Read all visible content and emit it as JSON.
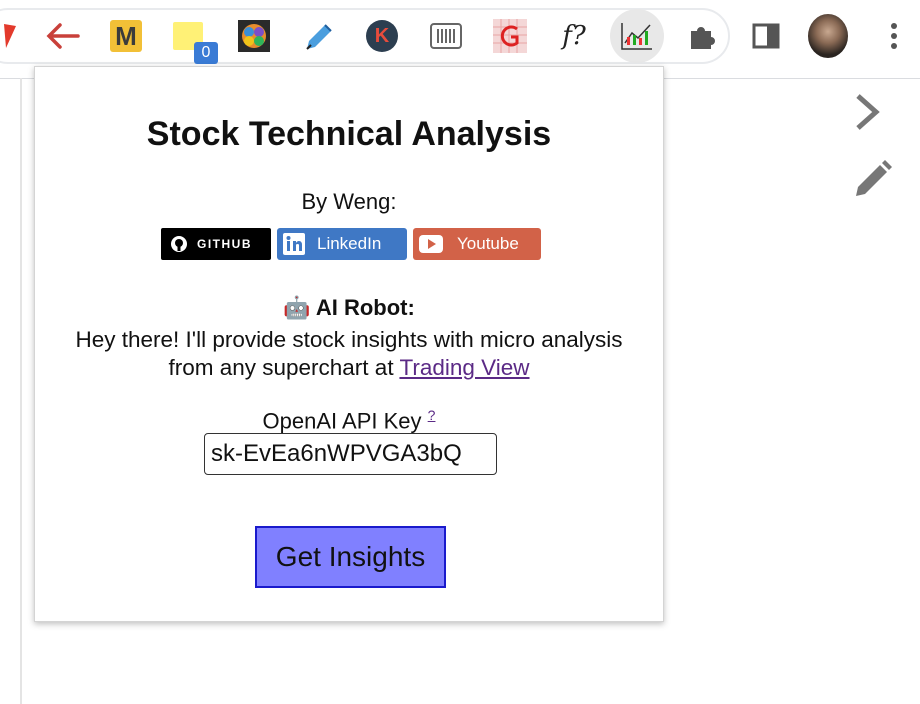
{
  "toolbar": {
    "icons": [
      "red-check-icon",
      "back-arrow-icon",
      "m-extension-icon",
      "sticky-note-icon",
      "brain-icon",
      "pen-icon",
      "k-icon",
      "barcode-icon",
      "grid-g-icon",
      "f-question-icon",
      "stock-chart-icon",
      "puzzle-icon",
      "sidepanel-icon",
      "avatar",
      "kebab-menu-icon"
    ],
    "m_letter": "M",
    "k_letter": "K",
    "fx_text": "f?",
    "sticky_badge": "0"
  },
  "popup": {
    "title": "Stock Technical Analysis",
    "byline": "By Weng:",
    "badges": {
      "github": "GITHUB",
      "linkedin": "LinkedIn",
      "youtube": "Youtube"
    },
    "robot_emoji": "🤖",
    "robot_title": "AI Robot:",
    "description_prefix": "Hey there! I'll provide stock insights with micro analysis from any superchart at",
    "trading_view_link": "Trading View",
    "api_label": "OpenAI API Key",
    "api_help": "?",
    "api_key_value": "sk-EvEa6nWPVGA3bQ",
    "get_insights_label": "Get Insights"
  },
  "colors": {
    "button_bg": "#8080ff",
    "button_border": "#1a1acc",
    "link": "#5b2a86",
    "linkedin": "#3f78c5",
    "youtube": "#d26248"
  }
}
